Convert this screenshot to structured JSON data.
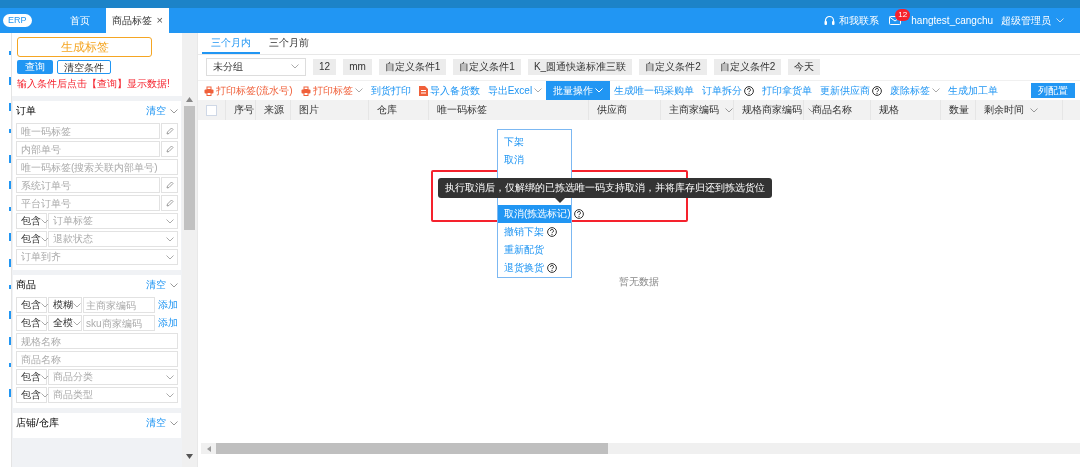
{
  "header": {
    "logo": "ERP",
    "tabs": [
      {
        "label": "首页",
        "selected": false
      },
      {
        "label": "商品标签",
        "selected": true,
        "close": "×"
      }
    ],
    "contact": "和我联系",
    "mail_badge": "12",
    "username": "hangtest_cangchu",
    "role": "超级管理员"
  },
  "filter_panel": {
    "generate_button": "生成标签",
    "query_button": "查询",
    "clear_button": "清空条件",
    "hint": "输入条件后点击【查询】显示数据!",
    "sections": [
      {
        "title": "订单",
        "clear": "清空",
        "fields": [
          {
            "kind": "text",
            "placeholder": "唯一码标签",
            "edit_icon": true
          },
          {
            "kind": "text",
            "placeholder": "内部单号",
            "edit_icon": true
          },
          {
            "kind": "text",
            "placeholder": "唯一码标签(搜索关联内部单号)"
          },
          {
            "kind": "text",
            "placeholder": "系统订单号",
            "edit_icon": true
          },
          {
            "kind": "text",
            "placeholder": "平台订单号",
            "edit_icon": true
          },
          {
            "kind": "select-pair",
            "operator": "包含",
            "placeholder": "订单标签"
          },
          {
            "kind": "select-pair",
            "operator": "包含",
            "placeholder": "退款状态"
          },
          {
            "kind": "select",
            "placeholder": "订单到齐"
          }
        ]
      },
      {
        "title": "商品",
        "clear": "清空",
        "fields": [
          {
            "kind": "match",
            "operator": "包含",
            "mode": "模糊",
            "placeholder": "主商家编码",
            "add": "添加"
          },
          {
            "kind": "match",
            "operator": "包含",
            "mode": "全模",
            "placeholder": "sku商家编码",
            "add": "添加"
          },
          {
            "kind": "text",
            "placeholder": "规格名称"
          },
          {
            "kind": "text",
            "placeholder": "商品名称"
          },
          {
            "kind": "select-pair",
            "operator": "包含",
            "placeholder": "商品分类"
          },
          {
            "kind": "select-pair",
            "operator": "包含",
            "placeholder": "商品类型"
          }
        ]
      },
      {
        "title": "店铺/仓库",
        "clear": "清空"
      }
    ]
  },
  "main": {
    "time_tabs": [
      {
        "label": "三个月内",
        "selected": true
      },
      {
        "label": "三个月前",
        "selected": false
      }
    ],
    "group_select": "未分组",
    "chips": [
      "12",
      "mm",
      "自定义条件1",
      "自定义条件1",
      "K_圆通快递标准三联",
      "自定义条件2",
      "自定义条件2",
      "今天"
    ],
    "actions": [
      {
        "label": "打印标签(流水号)",
        "selected": false
      },
      {
        "label": "打印标签",
        "dropdown": true,
        "selected": false
      },
      {
        "label": "到货打印",
        "selected": false
      },
      {
        "label": "导入备货数",
        "selected": false
      },
      {
        "label": "导出Excel",
        "dropdown": true,
        "selected": false
      },
      {
        "label": "批量操作",
        "dropdown": true,
        "selected": true
      },
      {
        "label": "生成唯一码采购单",
        "selected": false
      },
      {
        "label": "订单拆分",
        "help": true,
        "selected": false
      },
      {
        "label": "打印拿货单",
        "selected": false
      },
      {
        "label": "更新供应商",
        "help": true,
        "selected": false
      },
      {
        "label": "废除标签",
        "dropdown": true,
        "selected": false
      },
      {
        "label": "生成加工单",
        "selected": false
      }
    ],
    "column_config_button": "列配置",
    "table": {
      "columns": [
        {
          "kind": "checkbox",
          "checked": false
        },
        {
          "label": "序号",
          "kind": "text"
        },
        {
          "label": "来源",
          "kind": "text"
        },
        {
          "label": "图片",
          "kind": "text"
        },
        {
          "label": "仓库",
          "kind": "text"
        },
        {
          "label": "唯一码标签",
          "kind": "text"
        },
        {
          "label": "供应商",
          "kind": "text"
        },
        {
          "label": "主商家编码",
          "kind": "text",
          "sortable": true
        },
        {
          "label": "规格商家编码",
          "kind": "text",
          "sortable": true
        },
        {
          "label": "商品名称",
          "kind": "text"
        },
        {
          "label": "规格",
          "kind": "text"
        },
        {
          "label": "数量",
          "kind": "text"
        },
        {
          "label": "剩余时间",
          "kind": "text",
          "sortable": true
        }
      ],
      "empty_text": "暂无数据"
    },
    "batch_menu": [
      {
        "label": "下架",
        "selected": false
      },
      {
        "label": "取消",
        "selected": false
      },
      {
        "label": "取消(拣选标记)",
        "help": true,
        "selected": true
      },
      {
        "label": "撤销下架",
        "help": true,
        "selected": false
      },
      {
        "label": "重新配货",
        "selected": false
      },
      {
        "label": "退货换货",
        "help": true,
        "selected": false
      }
    ],
    "tooltip": "执行取消后，仅解绑的已拣选唯一码支持取消，并将库存归还到拣选货位"
  }
}
